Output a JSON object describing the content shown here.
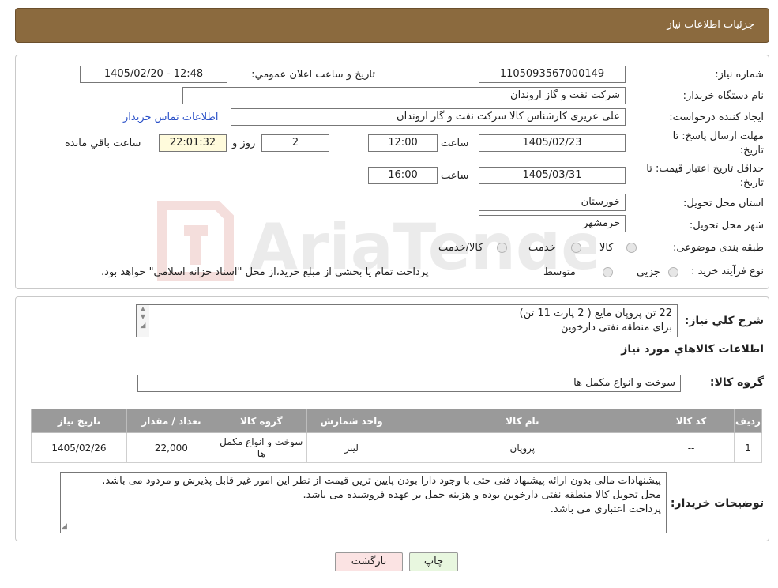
{
  "header": {
    "title": "جزئیات اطلاعات نیاز"
  },
  "info": {
    "need_number_label": "شماره نیاز:",
    "need_number": "1105093567000149",
    "announce_label": "تاریخ و ساعت اعلان عمومي:",
    "announce_value": "1405/02/20 - 12:48",
    "buyer_org_label": "نام دستگاه خريدار:",
    "buyer_org": "شرکت نفت و گاز اروندان",
    "creator_label": "ايجاد کننده درخواست:",
    "creator": "علی عزیزی کارشناس کالا شرکت نفت و گاز اروندان",
    "contact_link": "اطلاعات تماس خريدار",
    "reply_deadline_label": "مهلت ارسال پاسخ: تا تاريخ:",
    "reply_date": "1405/02/23",
    "time_label": "ساعت",
    "reply_time": "12:00",
    "days_value": "2",
    "days_label": "روز و",
    "remaining_time": "22:01:32",
    "remaining_label": "ساعت باقي مانده",
    "price_validity_label": "حداقل تاريخ اعتبار قيمت: تا تاريخ:",
    "price_date": "1405/03/31",
    "price_time": "16:00",
    "province_label": "استان محل تحويل:",
    "province": "خوزستان",
    "city_label": "شهر محل تحويل:",
    "city": "خرمشهر",
    "category_label": "طبقه بندی موضوعی:",
    "category_options": [
      "کالا",
      "خدمت",
      "کالا/خدمت"
    ],
    "process_label": "نوع فرآيند خريد :",
    "process_options": [
      "جزيي",
      "متوسط"
    ],
    "process_note": "پرداخت تمام یا بخشی از مبلغ خرید،از محل \"اسناد خزانه اسلامی\" خواهد بود."
  },
  "summary": {
    "label": "شرح كلي نياز:",
    "lines": [
      "22 تن پروپان مایع ( 2 پارت 11 تن)",
      "برای منطقه نفتی دارخوین"
    ]
  },
  "goods": {
    "section_title": "اطلاعات كالاهاي مورد نياز",
    "group_label": "گروه كالا:",
    "group_value": "سوخت و انواع مکمل ها",
    "columns": [
      "رديف",
      "کد کالا",
      "نام کالا",
      "واحد شمارش",
      "گروه کالا",
      "تعداد / مقدار",
      "تاريخ نياز"
    ],
    "rows": [
      {
        "row": "1",
        "code": "--",
        "name": "پروپان",
        "unit": "لیتر",
        "group": "سوخت و انواع مکمل ها",
        "qty": "22,000",
        "date": "1405/02/26"
      }
    ]
  },
  "buyer_notes": {
    "label": "توضيحات خريدار:",
    "lines": [
      "پیشنهادات مالی بدون ارائه پیشنهاد فنی حتی با وجود دارا بودن پایین ترین قیمت از نظر این امور غیر قابل پذیرش و مردود می باشد.",
      "محل تحویل کالا منطقه نفتی دارخوین بوده و هزینه حمل بر عهده فروشنده می باشد.",
      "پرداخت اعتباری می باشد."
    ]
  },
  "buttons": {
    "print": "چاپ",
    "back": "بازگشت"
  },
  "watermark": {
    "text": "AriaTender.neT"
  },
  "colors": {
    "header": "#8b6a3e",
    "link": "#2a50c8",
    "back_button": "#fbe3e3",
    "print_button": "#e8f7df"
  }
}
